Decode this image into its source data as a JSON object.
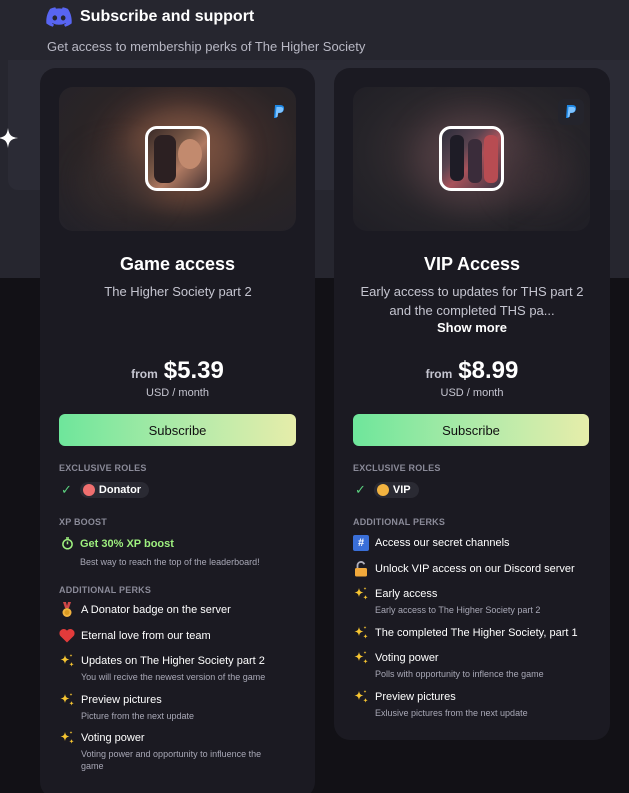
{
  "header": {
    "title": "Subscribe and support",
    "subtitle": "Get access to membership perks of The Higher Society"
  },
  "colors": {
    "accent_green": "#6ee69b",
    "page_bg": "#121116",
    "card_bg": "#1b1a22",
    "discord_blurple": "#5865f2",
    "paypal_blue": "#1e88e5",
    "donator_role": "#ef6f6f",
    "vip_role": "#f2b340",
    "xp_green": "#9ef07f"
  },
  "plans": [
    {
      "title": "Game access",
      "description": "The Higher Society part 2",
      "price_from_label": "from",
      "price": "$5.39",
      "price_unit": "USD / month",
      "subscribe_label": "Subscribe",
      "payment_icon": "paypal-icon",
      "exclusive_roles_label": "EXCLUSIVE ROLES",
      "role_name": "Donator",
      "xp_boost_label": "XP BOOST",
      "xp_boost_text": "Get 30% XP boost",
      "xp_boost_sub": "Best way to reach the top of the leaderboard!",
      "perks_label": "ADDITIONAL PERKS",
      "perks": [
        {
          "icon": "medal-icon",
          "title": "A Donator badge on the server",
          "desc": ""
        },
        {
          "icon": "heart-icon",
          "title": "Eternal love from our team",
          "desc": ""
        },
        {
          "icon": "sparkles-icon",
          "title": "Updates on The Higher Society part 2",
          "desc": "You will recive the newest version of the game"
        },
        {
          "icon": "sparkles-icon",
          "title": "Preview pictures",
          "desc": "Picture from the next update"
        },
        {
          "icon": "sparkles-icon",
          "title": "Voting power",
          "desc": "Voting power and opportunity to influence the game"
        }
      ]
    },
    {
      "title": "VIP Access",
      "description": "Early access to updates for THS part 2 and the completed THS pa...",
      "show_more_label": "Show more",
      "price_from_label": "from",
      "price": "$8.99",
      "price_unit": "USD / month",
      "subscribe_label": "Subscribe",
      "payment_icon": "paypal-icon",
      "exclusive_roles_label": "EXCLUSIVE ROLES",
      "role_name": "VIP",
      "perks_label": "ADDITIONAL PERKS",
      "perks": [
        {
          "icon": "hash-icon",
          "title": "Access our secret channels",
          "desc": ""
        },
        {
          "icon": "unlock-icon",
          "title": "Unlock VIP access on our Discord server",
          "desc": ""
        },
        {
          "icon": "sparkles-icon",
          "title": "Early access",
          "desc": "Early access to The Higher Society part 2"
        },
        {
          "icon": "sparkles-icon",
          "title": "The completed The Higher Society, part 1",
          "desc": ""
        },
        {
          "icon": "sparkles-icon",
          "title": "Voting power",
          "desc": "Polls with opportunity to inflence the game"
        },
        {
          "icon": "sparkles-icon",
          "title": "Preview pictures",
          "desc": "Exlusive pictures from the next update"
        }
      ]
    }
  ]
}
